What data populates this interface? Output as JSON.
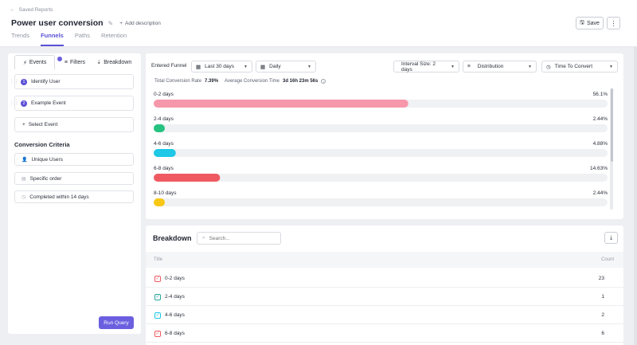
{
  "header": {
    "back_label": "Saved Reports",
    "title": "Power user conversion",
    "add_description": "Add description",
    "tabs": [
      "Trends",
      "Funnels",
      "Paths",
      "Retention"
    ],
    "active_tab": "Funnels",
    "save_label": "Save"
  },
  "left_panel": {
    "tabs": [
      "Events",
      "Filters",
      "Breakdown"
    ],
    "active_tab": "Events",
    "steps": [
      {
        "num": "1",
        "label": "Identify User"
      },
      {
        "num": "2",
        "label": "Example Event"
      }
    ],
    "select_event": "Select Event",
    "criteria_title": "Conversion Criteria",
    "criteria": [
      "Unique Users",
      "Specific order",
      "Completed within 14 days"
    ],
    "run_query": "Run Query"
  },
  "toolbar": {
    "entered_funnel": "Entered Funnel",
    "date_range": "Last 30 days",
    "granularity": "Daily",
    "interval": "Interval Size: 2 days",
    "view": "Distribution",
    "metric": "Time To Convert"
  },
  "summary": {
    "rate_label": "Total Conversion Rate",
    "rate_value": "7.39%",
    "avg_label": "Average Conversion Time",
    "avg_value": "3d 16h 23m 56s"
  },
  "chart_data": {
    "type": "bar",
    "orientation": "horizontal",
    "categories": [
      "0-2 days",
      "2-4 days",
      "4-6 days",
      "6-8 days",
      "8-10 days"
    ],
    "values": [
      56.1,
      2.44,
      4.88,
      14.63,
      2.44
    ],
    "value_labels": [
      "56.1%",
      "2.44%",
      "4.88%",
      "14.63%",
      "2.44%"
    ],
    "colors": [
      "#f797ab",
      "#26c281",
      "#1ec8e6",
      "#ef5a62",
      "#f7c815"
    ],
    "xlim": [
      0,
      100
    ]
  },
  "breakdown": {
    "title": "Breakdown",
    "search_placeholder": "Search...",
    "col_title": "Title",
    "col_count": "Count",
    "rows": [
      {
        "label": "0-2 days",
        "count": "23",
        "color": "#ef5a62"
      },
      {
        "label": "2-4 days",
        "count": "1",
        "color": "#26a69a"
      },
      {
        "label": "4-6 days",
        "count": "2",
        "color": "#1ec8e6"
      },
      {
        "label": "6-8 days",
        "count": "6",
        "color": "#ef5a62"
      }
    ]
  }
}
